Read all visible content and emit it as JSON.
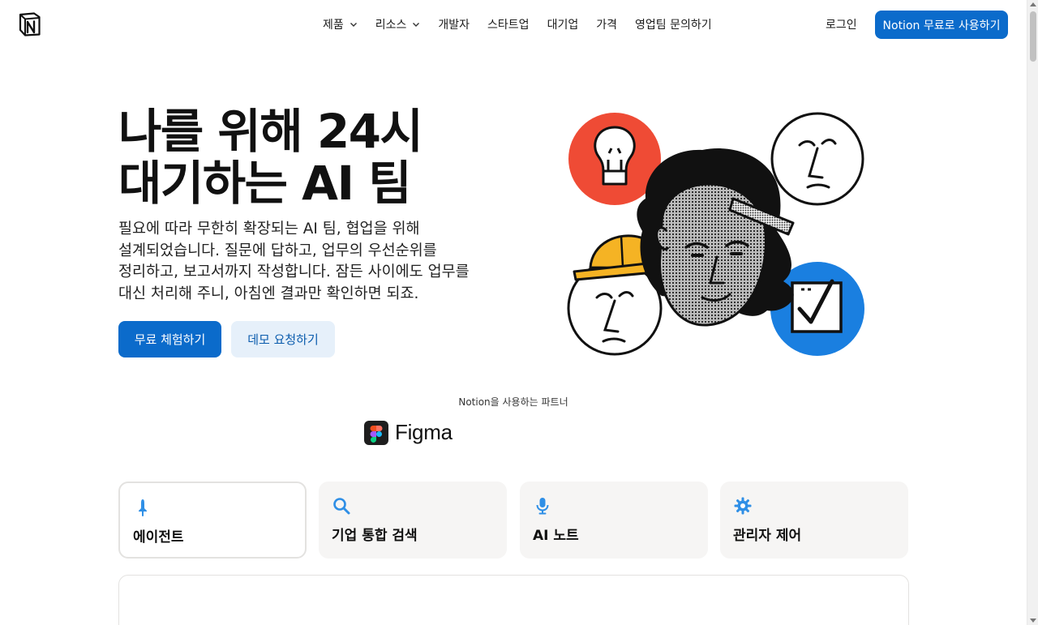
{
  "nav": {
    "logo_icon": "notion-logo-icon",
    "items": [
      {
        "label": "제품",
        "has_dropdown": true
      },
      {
        "label": "리소스",
        "has_dropdown": true
      },
      {
        "label": "개발자",
        "has_dropdown": false
      },
      {
        "label": "스타트업",
        "has_dropdown": false
      },
      {
        "label": "대기업",
        "has_dropdown": false
      },
      {
        "label": "가격",
        "has_dropdown": false
      },
      {
        "label": "영업팀 문의하기",
        "has_dropdown": false
      }
    ],
    "login": "로그인",
    "cta": "Notion 무료로 사용하기"
  },
  "hero": {
    "title_line1": "나를 위해 24시",
    "title_line2": "대기하는 AI 팀",
    "subtitle_line1": "필요에 따라 무한히 확장되는 AI 팀, 협업을 위해",
    "subtitle_line2": "설계되었습니다. 질문에 답하고, 업무의 우선순위를",
    "subtitle_line3": "정리하고, 보고서까지 작성합니다. 잠든 사이에도 업무를",
    "subtitle_line4": "대신 처리해 주니, 아침엔 결과만 확인하면 되죠.",
    "primary_button": "무료 체험하기",
    "secondary_button": "데모 요청하기"
  },
  "partners": {
    "label": "Notion을 사용하는 파트너",
    "logo_text": "Figma"
  },
  "features": [
    {
      "label": "에이전트",
      "icon": "agent-pin-icon",
      "active": true
    },
    {
      "label": "기업 통합 검색",
      "icon": "search-icon",
      "active": false
    },
    {
      "label": "AI 노트",
      "icon": "microphone-icon",
      "active": false
    },
    {
      "label": "관리자 제어",
      "icon": "gear-icon",
      "active": false
    }
  ],
  "colors": {
    "accent": "#0b6bcb",
    "accent_soft": "#e6f0fa",
    "illus_red": "#ef4b35",
    "illus_blue": "#1a7fe0",
    "illus_yellow": "#f5b324",
    "card_bg": "#f6f5f4"
  }
}
